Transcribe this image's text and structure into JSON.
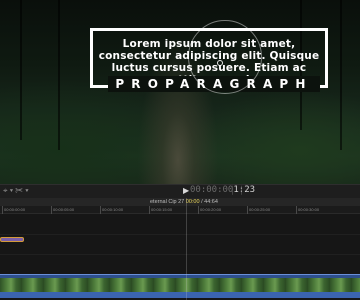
{
  "viewer": {
    "title_text": "Lorem ipsum dolor sit amet, consectetur adipiscing elit. Quisque luctus cursus posuere. Etiam ac porttitor mauris.",
    "brand_text": "PROPARAGRAPH"
  },
  "controls": {
    "left_icons": "⌖ ▾  ✂ ▾",
    "play_icon": "▶",
    "timecode_dim": "00:00:00",
    "timecode_bright": "1:23",
    "right_icons": "⎸⎸"
  },
  "timeline": {
    "project_name": "eternal Cip 27",
    "duration_highlight": "00:00",
    "duration_total": " / 44:64"
  },
  "ruler_ticks": [
    "00:00:00:00",
    "00:00:05:00",
    "00:00:10:00",
    "00:00:15:00",
    "00:00:20:00",
    "00:00:25:00",
    "00:00:30:00"
  ]
}
